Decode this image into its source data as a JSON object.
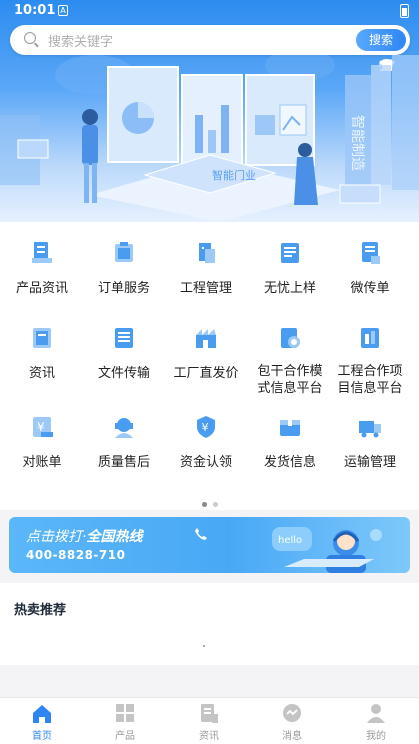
{
  "status_bar": {
    "time": "10:01",
    "notification_glyph": "A"
  },
  "search": {
    "placeholder": "搜索关键字",
    "button_label": "搜索"
  },
  "hero": {
    "logo_text": "智能门业",
    "side_text": "智能制造"
  },
  "menu": {
    "items": [
      {
        "label": "产品资讯",
        "icon": "product-info-icon"
      },
      {
        "label": "订单服务",
        "icon": "order-service-icon"
      },
      {
        "label": "工程管理",
        "icon": "project-management-icon"
      },
      {
        "label": "无忧上样",
        "icon": "sample-icon"
      },
      {
        "label": "微传单",
        "icon": "flyer-icon"
      },
      {
        "label": "资讯",
        "icon": "news-icon"
      },
      {
        "label": "文件传输",
        "icon": "file-transfer-icon"
      },
      {
        "label": "工厂直发价",
        "icon": "factory-price-icon"
      },
      {
        "label": "包干合作模式信息平台",
        "icon": "contract-platform-icon"
      },
      {
        "label": "工程合作项目信息平台",
        "icon": "project-platform-icon"
      },
      {
        "label": "对账单",
        "icon": "statement-icon"
      },
      {
        "label": "质量售后",
        "icon": "after-sales-icon"
      },
      {
        "label": "资金认领",
        "icon": "fund-claim-icon"
      },
      {
        "label": "发货信息",
        "icon": "shipping-info-icon"
      },
      {
        "label": "运输管理",
        "icon": "transport-icon"
      }
    ],
    "page_indicator": {
      "current": 1,
      "total": 2
    }
  },
  "hotline": {
    "title_prefix": "点击拨打·",
    "title_strong": "全国热线",
    "number": "400-8828-710",
    "bubble_text": "hello"
  },
  "hot_section": {
    "title": "热卖推荐"
  },
  "tabbar": {
    "items": [
      {
        "label": "首页",
        "active": true
      },
      {
        "label": "产品",
        "active": false
      },
      {
        "label": "资讯",
        "active": false
      },
      {
        "label": "消息",
        "active": false
      },
      {
        "label": "我的",
        "active": false
      }
    ]
  },
  "colors": {
    "accent": "#2f86f2",
    "icon_blue": "#4a9cf0",
    "inactive": "#9a9a9a"
  }
}
